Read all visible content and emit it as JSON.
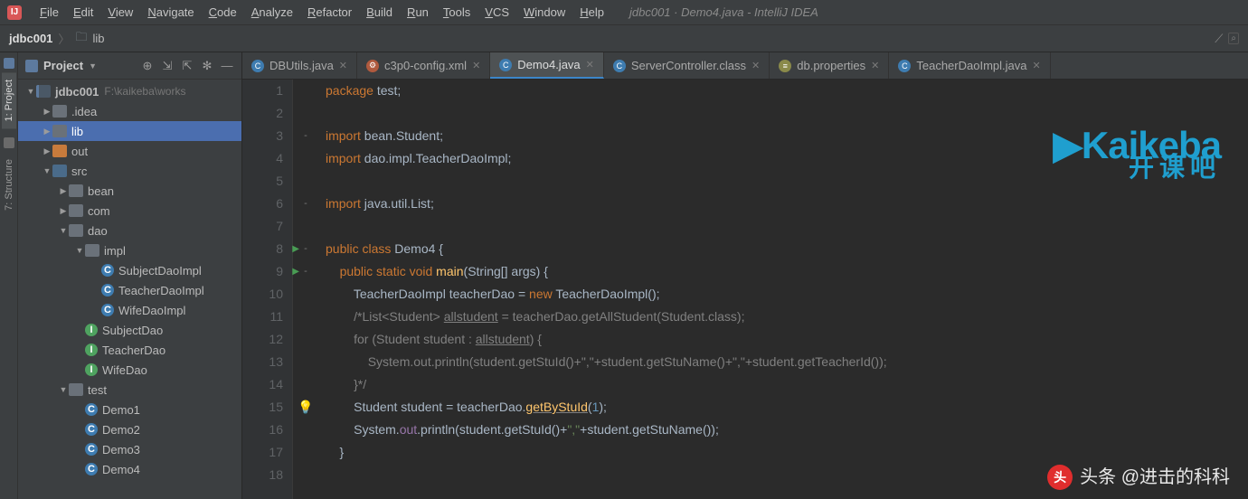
{
  "window": {
    "title": "jdbc001 · Demo4.java - IntelliJ IDEA"
  },
  "menu": {
    "items": [
      "File",
      "Edit",
      "View",
      "Navigate",
      "Code",
      "Analyze",
      "Refactor",
      "Build",
      "Run",
      "Tools",
      "VCS",
      "Window",
      "Help"
    ]
  },
  "breadcrumb": {
    "project": "jdbc001",
    "folder": "lib"
  },
  "sidebar": {
    "title": "Project",
    "nodes": [
      {
        "depth": 0,
        "arrow": "down",
        "icon": "module",
        "label": "jdbc001",
        "path": "F:\\kaikeba\\works",
        "selected": false,
        "bold": true
      },
      {
        "depth": 1,
        "arrow": "right",
        "icon": "folder",
        "label": ".idea"
      },
      {
        "depth": 1,
        "arrow": "right",
        "icon": "folder",
        "label": "lib",
        "selected": true
      },
      {
        "depth": 1,
        "arrow": "right",
        "icon": "folder-orange",
        "label": "out"
      },
      {
        "depth": 1,
        "arrow": "down",
        "icon": "folder-blue",
        "label": "src"
      },
      {
        "depth": 2,
        "arrow": "right",
        "icon": "folder",
        "label": "bean"
      },
      {
        "depth": 2,
        "arrow": "right",
        "icon": "folder",
        "label": "com"
      },
      {
        "depth": 2,
        "arrow": "down",
        "icon": "folder",
        "label": "dao"
      },
      {
        "depth": 3,
        "arrow": "down",
        "icon": "folder",
        "label": "impl"
      },
      {
        "depth": 4,
        "arrow": "",
        "icon": "class",
        "iconText": "C",
        "label": "SubjectDaoImpl"
      },
      {
        "depth": 4,
        "arrow": "",
        "icon": "class",
        "iconText": "C",
        "label": "TeacherDaoImpl"
      },
      {
        "depth": 4,
        "arrow": "",
        "icon": "class",
        "iconText": "C",
        "label": "WifeDaoImpl"
      },
      {
        "depth": 3,
        "arrow": "",
        "icon": "interface",
        "iconText": "I",
        "label": "SubjectDao"
      },
      {
        "depth": 3,
        "arrow": "",
        "icon": "interface",
        "iconText": "I",
        "label": "TeacherDao"
      },
      {
        "depth": 3,
        "arrow": "",
        "icon": "interface",
        "iconText": "I",
        "label": "WifeDao"
      },
      {
        "depth": 2,
        "arrow": "down",
        "icon": "folder",
        "label": "test"
      },
      {
        "depth": 3,
        "arrow": "",
        "icon": "class",
        "iconText": "C",
        "label": "Demo1"
      },
      {
        "depth": 3,
        "arrow": "",
        "icon": "class",
        "iconText": "C",
        "label": "Demo2"
      },
      {
        "depth": 3,
        "arrow": "",
        "icon": "class",
        "iconText": "C",
        "label": "Demo3"
      },
      {
        "depth": 3,
        "arrow": "",
        "icon": "class",
        "iconText": "C",
        "label": "Demo4"
      }
    ]
  },
  "leftTabs": {
    "t1": "1: Project",
    "t2": "7: Structure"
  },
  "tabs": [
    {
      "icon": "java",
      "label": "DBUtils.java",
      "active": false
    },
    {
      "icon": "xml",
      "label": "c3p0-config.xml",
      "active": false
    },
    {
      "icon": "java",
      "label": "Demo4.java",
      "active": true
    },
    {
      "icon": "java",
      "label": "ServerController.class",
      "active": false
    },
    {
      "icon": "prop",
      "label": "db.properties",
      "active": false
    },
    {
      "icon": "java",
      "label": "TeacherDaoImpl.java",
      "active": false
    }
  ],
  "code": {
    "lines": [
      {
        "n": "1",
        "html": "<span class='kw'>package</span> test;"
      },
      {
        "n": "2",
        "html": ""
      },
      {
        "n": "3",
        "html": "<span class='kw'>import</span> bean.Student;",
        "fold": "-"
      },
      {
        "n": "4",
        "html": "<span class='kw'>import</span> dao.impl.TeacherDaoImpl;"
      },
      {
        "n": "5",
        "html": ""
      },
      {
        "n": "6",
        "html": "<span class='kw'>import</span> java.util.List;",
        "fold": "-"
      },
      {
        "n": "7",
        "html": ""
      },
      {
        "n": "8",
        "html": "<span class='kw'>public class</span> <span class='cls'>Demo4</span> {",
        "run": true,
        "fold": "-"
      },
      {
        "n": "9",
        "html": "    <span class='kw'>public static void</span> <span class='fn'>main</span>(String[] args) {",
        "run": true,
        "fold": "-"
      },
      {
        "n": "10",
        "html": "        TeacherDaoImpl teacherDao = <span class='kw'>new</span> TeacherDaoImpl();"
      },
      {
        "n": "11",
        "html": "        <span class='cmt'>/*List&lt;Student&gt; <span class='under'>allstudent</span> = teacherDao.getAllStudent(Student.class);</span>"
      },
      {
        "n": "12",
        "html": "        <span class='cmt'>for (Student student : <span class='under'>allstudent</span>) {</span>"
      },
      {
        "n": "13",
        "html": "            <span class='cmt'>System.out.println(student.getStuId()+\",\"+student.getStuName()+\",\"+student.getTeacherId());</span>"
      },
      {
        "n": "14",
        "html": "        <span class='cmt'>}*/</span>"
      },
      {
        "n": "15",
        "html": "        Student student = teacherDao.<span class='fn under'>getByStuId</span>(<span class='num'>1</span>);",
        "bulb": true
      },
      {
        "n": "16",
        "html": "        System.<span class='field'>out</span>.println(student.getStuId()+<span class='str'>\",\"</span>+student.getStuName());"
      },
      {
        "n": "17",
        "html": "    }"
      },
      {
        "n": "18",
        "html": ""
      }
    ]
  },
  "watermark": {
    "brand": "aikeba",
    "brandSub": "开课吧",
    "toutiao": "头条 @进击的科科"
  }
}
